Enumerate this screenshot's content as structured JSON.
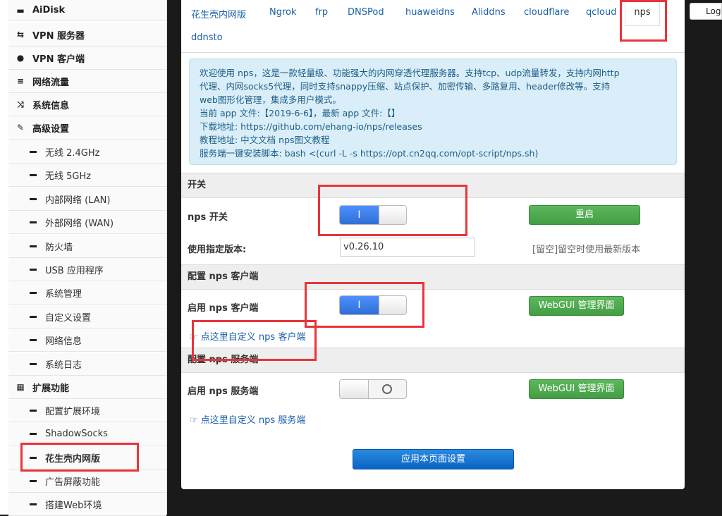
{
  "sidebar": {
    "top_items": [
      {
        "label": "AiDisk",
        "icon": "hdd-icon"
      },
      {
        "label": "VPN 服务器",
        "icon": "vpn-server-icon"
      },
      {
        "label": "VPN 客户端",
        "icon": "globe-icon"
      },
      {
        "label": "网络流量",
        "icon": "traffic-icon"
      },
      {
        "label": "系统信息",
        "icon": "shuffle-icon"
      },
      {
        "label": "高级设置",
        "icon": "wrench-icon"
      }
    ],
    "advanced_items": [
      "无线 2.4GHz",
      "无线 5GHz",
      "内部网络 (LAN)",
      "外部网络 (WAN)",
      "防火墙",
      "USB 应用程序",
      "系统管理",
      "自定义设置",
      "网络信息",
      "系统日志"
    ],
    "ext_label": "扩展功能",
    "ext_items": [
      "配置扩展环境",
      "ShadowSocks",
      "花生壳内网版",
      "广告屏蔽功能",
      "搭建Web环境"
    ]
  },
  "tabs": [
    "花生壳内网版",
    "Ngrok",
    "frp",
    "DNSPod",
    "huaweidns",
    "Aliddns",
    "cloudflare",
    "qcloud",
    "nps",
    "ddnsto"
  ],
  "info": [
    "欢迎使用 nps，这是一款轻量级、功能强大的内网穿透代理服务器。支持tcp、udp流量转发，支持内网http",
    "代理、内网socks5代理，同时支持snappy压缩、站点保护、加密传输、多路复用、header修改等。支持",
    "web图形化管理，集成多用户模式。",
    "当前 app 文件:【2019-6-6】，最新 app 文件:【】",
    "下载地址: https://github.com/ehang-io/nps/releases",
    "教程地址: 中文文档 nps图文教程",
    "服务端一键安装脚本: bash <(curl -L -s https://opt.cn2qq.com/opt-script/nps.sh)"
  ],
  "switch_section": {
    "title": "开关",
    "nps_label": "nps 开关",
    "nps_on": "I",
    "restart_label": "重启",
    "version_label": "使用指定版本:",
    "version_value": "v0.26.10",
    "version_hint": "[留空]留空时使用最新版本"
  },
  "client_section": {
    "title": "配置 nps 客户端",
    "enable_label": "启用 nps 客户端",
    "toggle_on": "I",
    "webgui_label": "WebGUI 管理界面",
    "custom_link": "点这里自定义 nps 客户端"
  },
  "server_section": {
    "title": "配置 nps 服务端",
    "enable_label": "启用 nps 服务端",
    "webgui_label": "WebGUI 管理界面",
    "custom_link": "点这里自定义 nps 服务端"
  },
  "apply_label": "应用本页面设置",
  "log_label": "Log",
  "colors": {
    "accent_blue": "#2f6fd4",
    "green": "#5cb85c",
    "highlight_red": "#e8343a",
    "info_bg": "#d9eef8"
  }
}
